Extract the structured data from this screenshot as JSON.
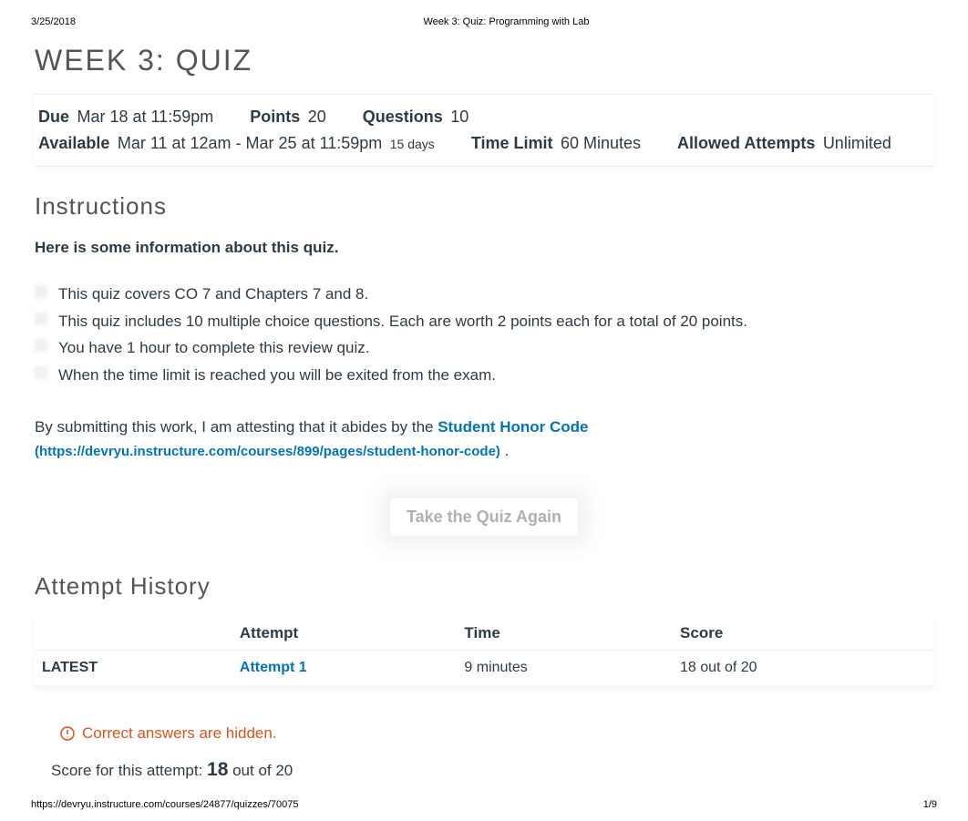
{
  "print": {
    "date": "3/25/2018",
    "doc_title": "Week 3: Quiz: Programming with Lab",
    "footer_url": "https://devryu.instructure.com/courses/24877/quizzes/70075",
    "page_num": "1/9"
  },
  "page": {
    "title": "WEEK 3: QUIZ"
  },
  "meta": {
    "due_label": "Due",
    "due_value": "Mar 18 at 11:59pm",
    "points_label": "Points",
    "points_value": "20",
    "questions_label": "Questions",
    "questions_value": "10",
    "avail_label": "Available",
    "avail_value": "Mar 11 at 12am - Mar 25 at 11:59pm",
    "avail_sub": "15 days",
    "timelimit_label": "Time Limit",
    "timelimit_value": "60 Minutes",
    "attempts_label": "Allowed Attempts",
    "attempts_value": "Unlimited"
  },
  "instructions": {
    "heading": "Instructions",
    "intro": "Here is some information about this quiz.",
    "bullets": [
      "This quiz covers CO 7 and Chapters 7 and 8.",
      "This quiz includes 10 multiple choice questions. Each are worth 2 points each for a total of 20 points.",
      "You have 1 hour to complete this review quiz.",
      "When the time limit is reached you will be exited from the exam."
    ],
    "attest_prefix": "By submitting this work, I am attesting that it abides by the ",
    "honor_text": "Student Honor Code",
    "honor_url_text": "(https://devryu.instructure.com/courses/899/pages/student-honor-code)",
    "attest_suffix": " ."
  },
  "take_again": "Take the Quiz Again",
  "history": {
    "heading": "Attempt History",
    "headers": {
      "blank": "",
      "attempt": "Attempt",
      "time": "Time",
      "score": "Score"
    },
    "rows": [
      {
        "tag": "LATEST",
        "attempt": "Attempt 1",
        "time": "9 minutes",
        "score": "18 out of 20"
      }
    ]
  },
  "hidden_answers": "Correct answers are hidden.",
  "score": {
    "prefix": "Score for this attempt: ",
    "value": "18",
    "suffix": " out of 20"
  }
}
